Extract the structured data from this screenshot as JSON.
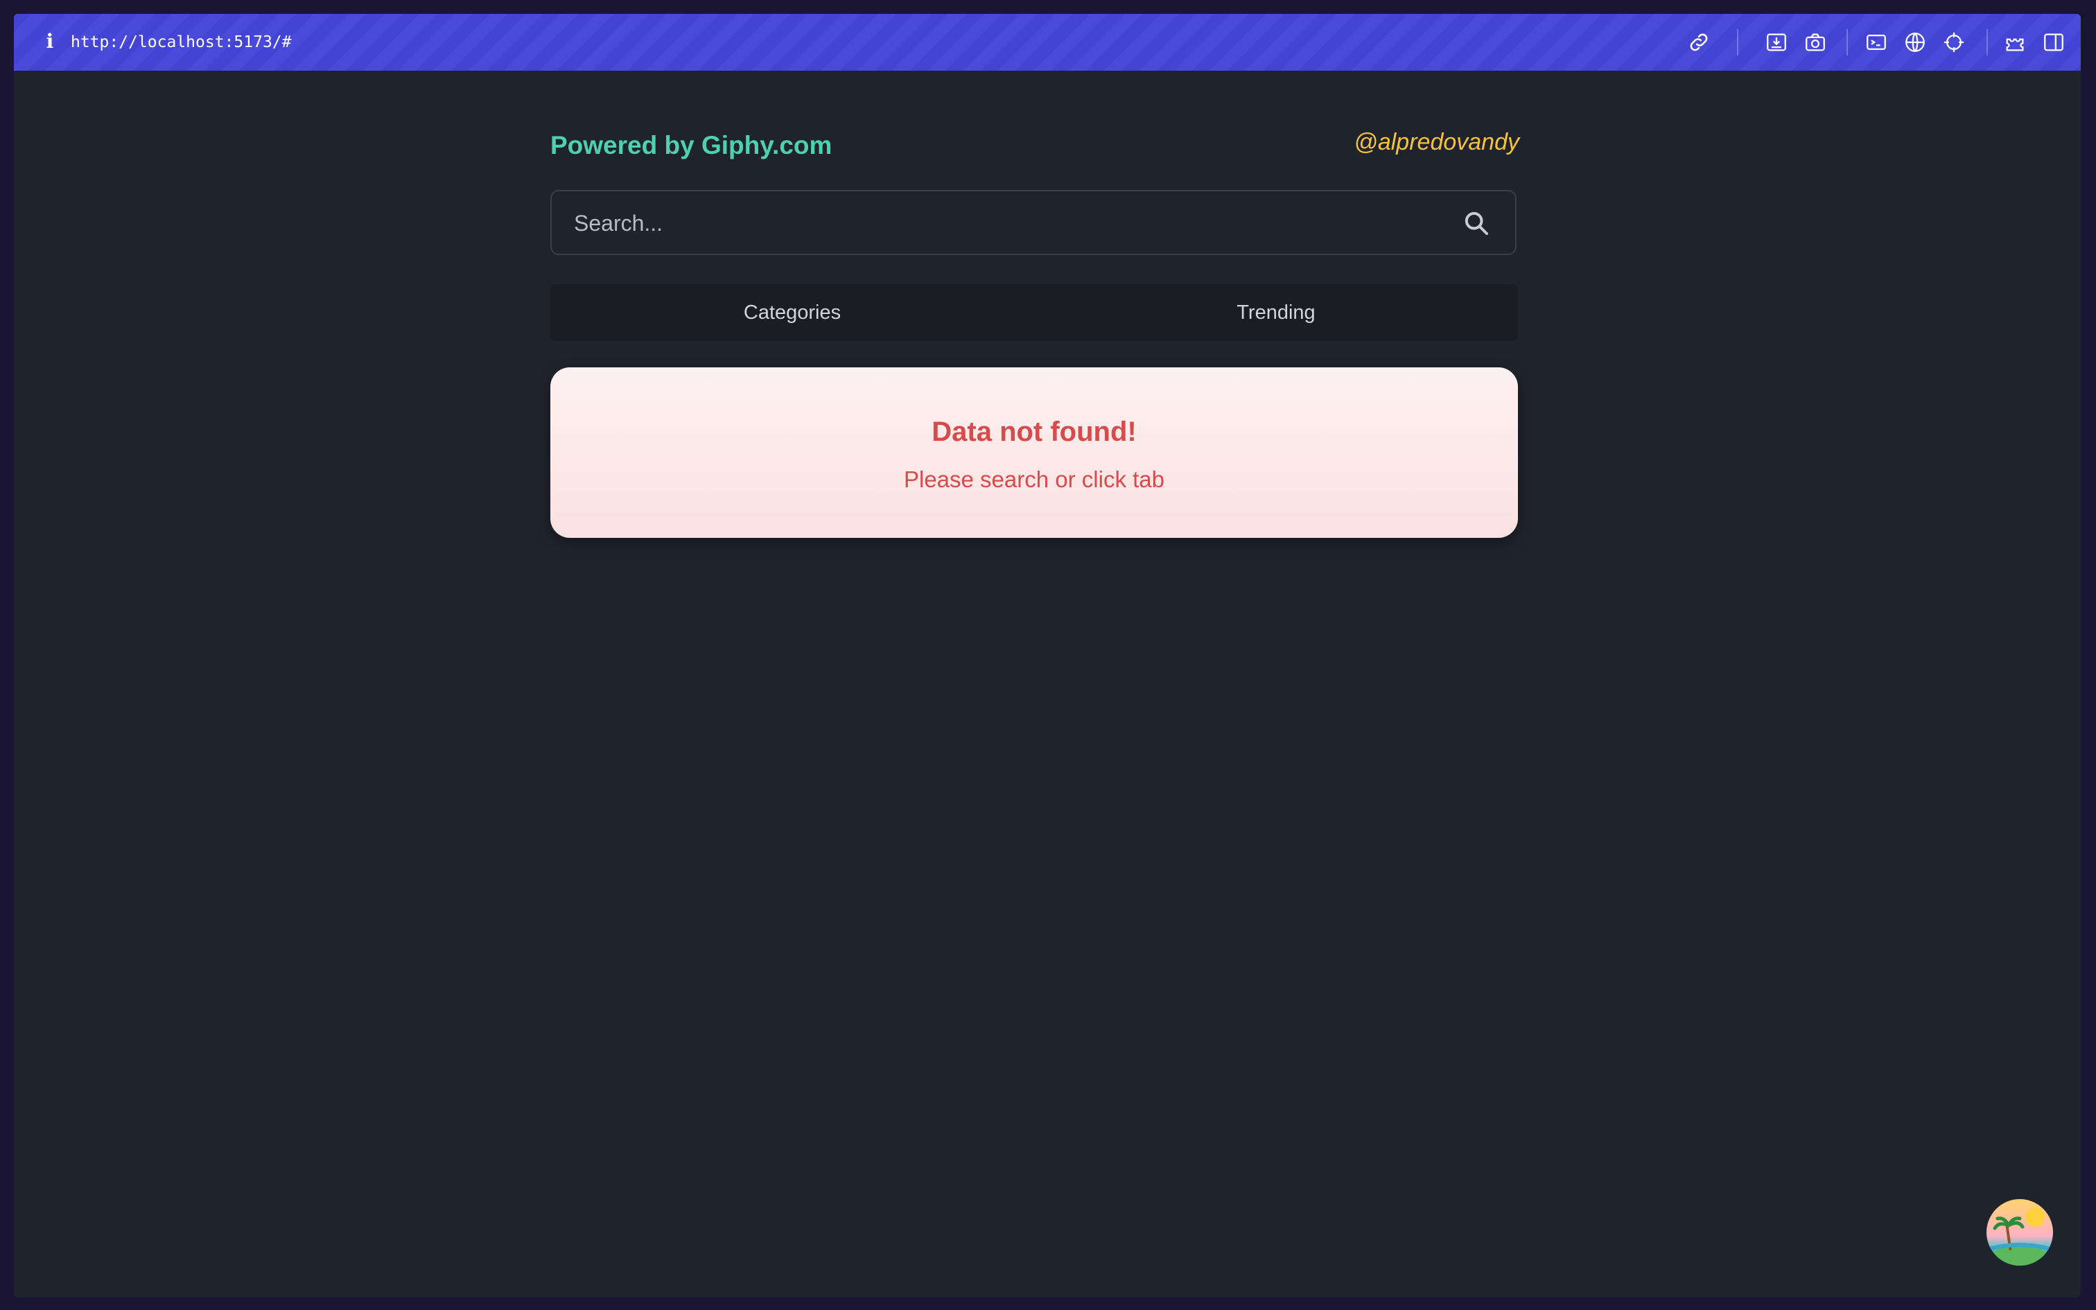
{
  "browser": {
    "url": "http://localhost:5173/#",
    "toolbar_icons": [
      "link-icon",
      "download-icon",
      "camera-icon",
      "terminal-icon",
      "globe-icon",
      "crosshair-icon",
      "extensions-icon",
      "sidebar-icon"
    ]
  },
  "header": {
    "brand": "Powered by Giphy.com",
    "handle": "@alpredovandy"
  },
  "search": {
    "placeholder": "Search..."
  },
  "tabs": [
    {
      "label": "Categories"
    },
    {
      "label": "Trending"
    }
  ],
  "empty_state": {
    "title": "Data not found!",
    "message": "Please search or click tab"
  },
  "colors": {
    "brand": "#4fd1b0",
    "handle": "#f6c23e",
    "error_text": "#d94a4a",
    "browserbar": "#4444d4",
    "page_bg": "#1f232b"
  }
}
